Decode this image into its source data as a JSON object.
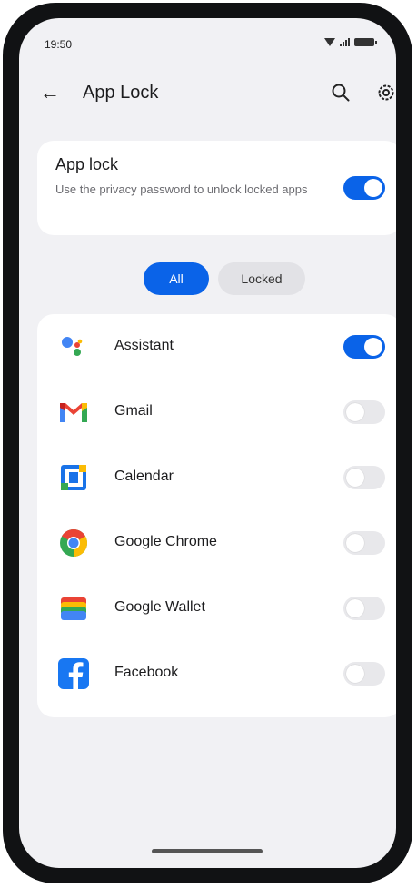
{
  "status": {
    "time": "19:50"
  },
  "appbar": {
    "back_glyph": "←",
    "title": "App Lock"
  },
  "applock": {
    "heading": "App lock",
    "description": "Use the privacy password to unlock locked apps",
    "enabled": true
  },
  "filters": [
    {
      "label": "All",
      "active": true
    },
    {
      "label": "Locked",
      "active": false
    }
  ],
  "apps": [
    {
      "name": "Assistant",
      "icon": "assistant-icon",
      "locked": true
    },
    {
      "name": "Gmail",
      "icon": "gmail-icon",
      "locked": false
    },
    {
      "name": "Calendar",
      "icon": "calendar-icon",
      "locked": false
    },
    {
      "name": "Google Chrome",
      "icon": "chrome-icon",
      "locked": false
    },
    {
      "name": "Google Wallet",
      "icon": "wallet-icon",
      "locked": false
    },
    {
      "name": "Facebook",
      "icon": "facebook-icon",
      "locked": false
    }
  ],
  "colors": {
    "accent": "#0a63e8",
    "background": "#f1f1f4",
    "card": "#ffffff",
    "toggle_off": "#e8e8eb"
  }
}
